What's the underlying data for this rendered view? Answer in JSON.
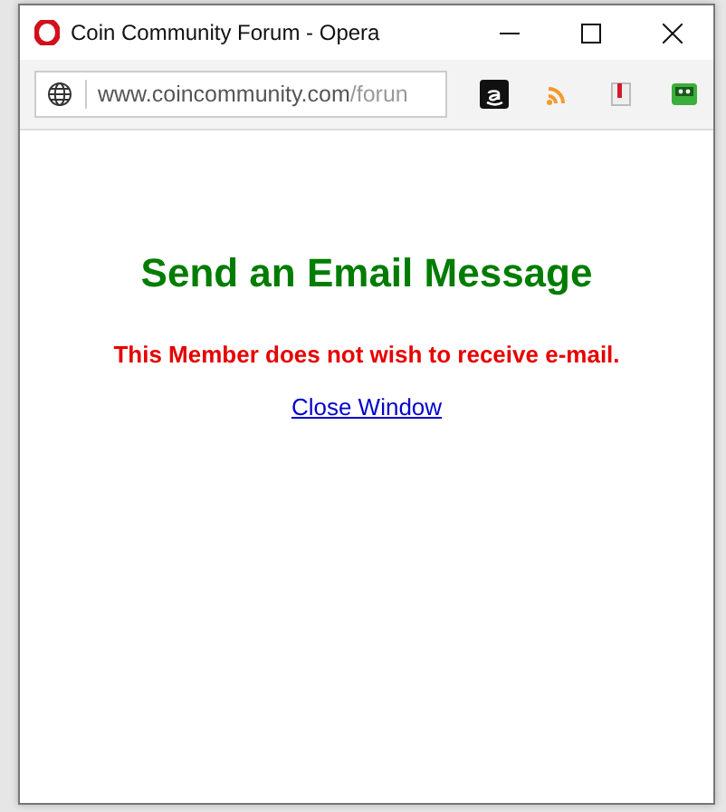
{
  "window": {
    "title": "Coin Community Forum - Opera"
  },
  "address_bar": {
    "url_host": "www.coincommunity.com",
    "url_path": "/forun"
  },
  "page": {
    "heading": "Send an Email Message",
    "notice": "This Member does not wish to receive e-mail.",
    "link": "Close Window"
  }
}
